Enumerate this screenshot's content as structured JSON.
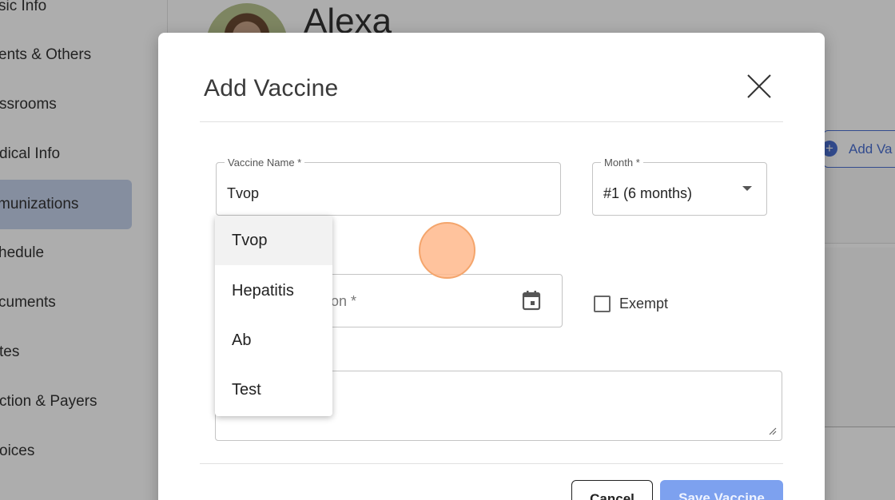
{
  "sidebar": {
    "items": [
      {
        "label": "sic Info"
      },
      {
        "label": "ents & Others"
      },
      {
        "label": "ssrooms"
      },
      {
        "label": "dical Info"
      },
      {
        "label": "munizations"
      },
      {
        "label": "hedule"
      },
      {
        "label": "cuments"
      },
      {
        "label": "tes"
      },
      {
        "label": "ction & Payers"
      },
      {
        "label": "oices"
      }
    ]
  },
  "profile": {
    "name": "Alexa"
  },
  "page_actions": {
    "add_vaccine_label": "Add Va"
  },
  "modal": {
    "title": "Add Vaccine",
    "vaccine_name": {
      "label": "Vaccine Name *",
      "value": "Tvop"
    },
    "month": {
      "label": "Month *",
      "value": "#1 (6 months)"
    },
    "date": {
      "placeholder": "tion *"
    },
    "exempt_label": "Exempt",
    "cancel_label": "Cancel",
    "save_label": "Save Vaccine"
  },
  "autocomplete": {
    "options": [
      "Tvop",
      "Hepatitis",
      "Ab",
      "Test"
    ],
    "highlighted_index": 0
  },
  "colors": {
    "accent": "#4a6fd1",
    "save_button": "#7da1ef",
    "active_nav": "#c5d1ea",
    "click_indicator": "#f4a56c"
  }
}
